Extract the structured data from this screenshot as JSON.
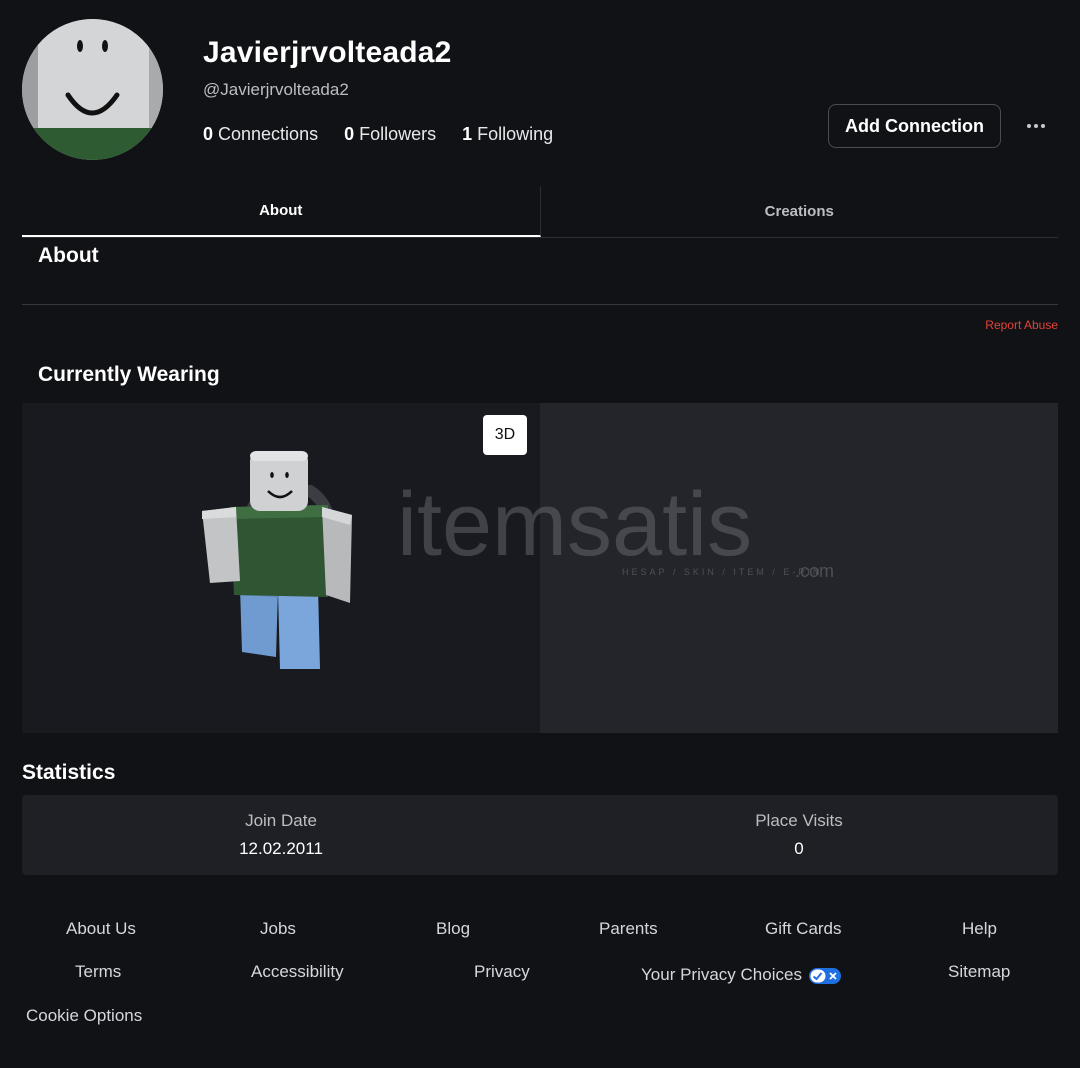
{
  "profile": {
    "display_name": "Javierjrvolteada2",
    "handle": "@Javierjrvolteada2",
    "connections_count": "0",
    "connections_label": " Connections",
    "followers_count": "0",
    "followers_label": " Followers",
    "following_count": "1",
    "following_label": " Following",
    "add_connection_label": "Add Connection"
  },
  "tabs": [
    {
      "label": "About",
      "active": true
    },
    {
      "label": "Creations",
      "active": false
    }
  ],
  "about": {
    "title": "About",
    "report_abuse": "Report Abuse"
  },
  "wearing": {
    "title": "Currently Wearing",
    "toggle_3d": "3D",
    "watermark_text": "itemsatis",
    "watermark_sub": "HESAP / SKIN / ITEM / E-PIN",
    "watermark_com": ".com"
  },
  "statistics": {
    "title": "Statistics",
    "join_date_label": "Join Date",
    "join_date_value": "12.02.2011",
    "place_visits_label": "Place Visits",
    "place_visits_value": "0"
  },
  "footer": {
    "links": [
      "About Us",
      "Jobs",
      "Blog",
      "Parents",
      "Gift Cards",
      "Help",
      "Terms",
      "Accessibility",
      "Privacy",
      "Your Privacy Choices",
      "Sitemap",
      "Cookie Options"
    ]
  },
  "colors": {
    "background": "#111216",
    "report_abuse": "#e0443a",
    "privacy_toggle": "#1f6fe0"
  }
}
